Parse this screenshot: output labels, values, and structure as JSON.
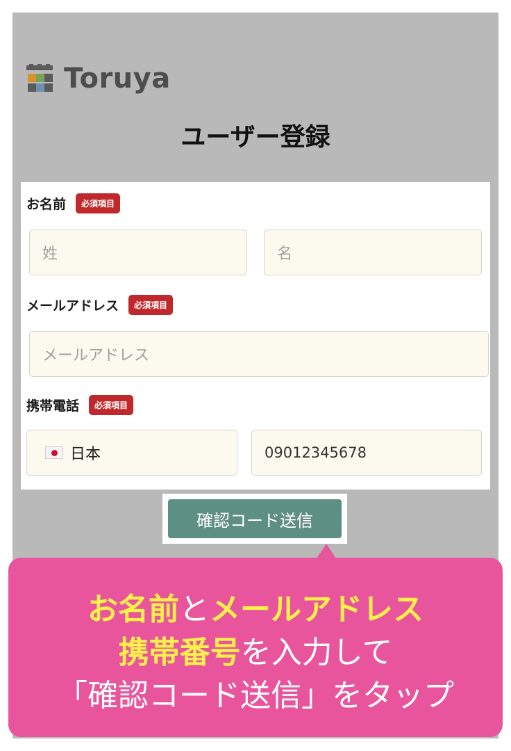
{
  "app": {
    "name": "Toruya"
  },
  "page": {
    "title": "ユーザー登録"
  },
  "form": {
    "name_label": "お名前",
    "email_label": "メールアドレス",
    "phone_label": "携帯電話",
    "required_badge": "必須項目",
    "last_name_placeholder": "姓",
    "first_name_placeholder": "名",
    "email_placeholder": "メールアドレス",
    "country": "日本",
    "phone_value": "09012345678"
  },
  "send_button": "確認コード送信",
  "callout": {
    "line1": {
      "part1": "お名前",
      "part2": "と",
      "part3": "メールアドレス"
    },
    "line2": {
      "part1": "携帯番号",
      "part2": "を入力して"
    },
    "line3": "「確認コード送信」をタップ"
  },
  "colors": {
    "badge": "#c0282b",
    "send_button": "#5e8f84",
    "callout": "#e8559c",
    "callout_highlight": "#fff04a"
  },
  "icons": {
    "logo": "calendar-grid-icon",
    "flag": "japan-flag-icon"
  }
}
